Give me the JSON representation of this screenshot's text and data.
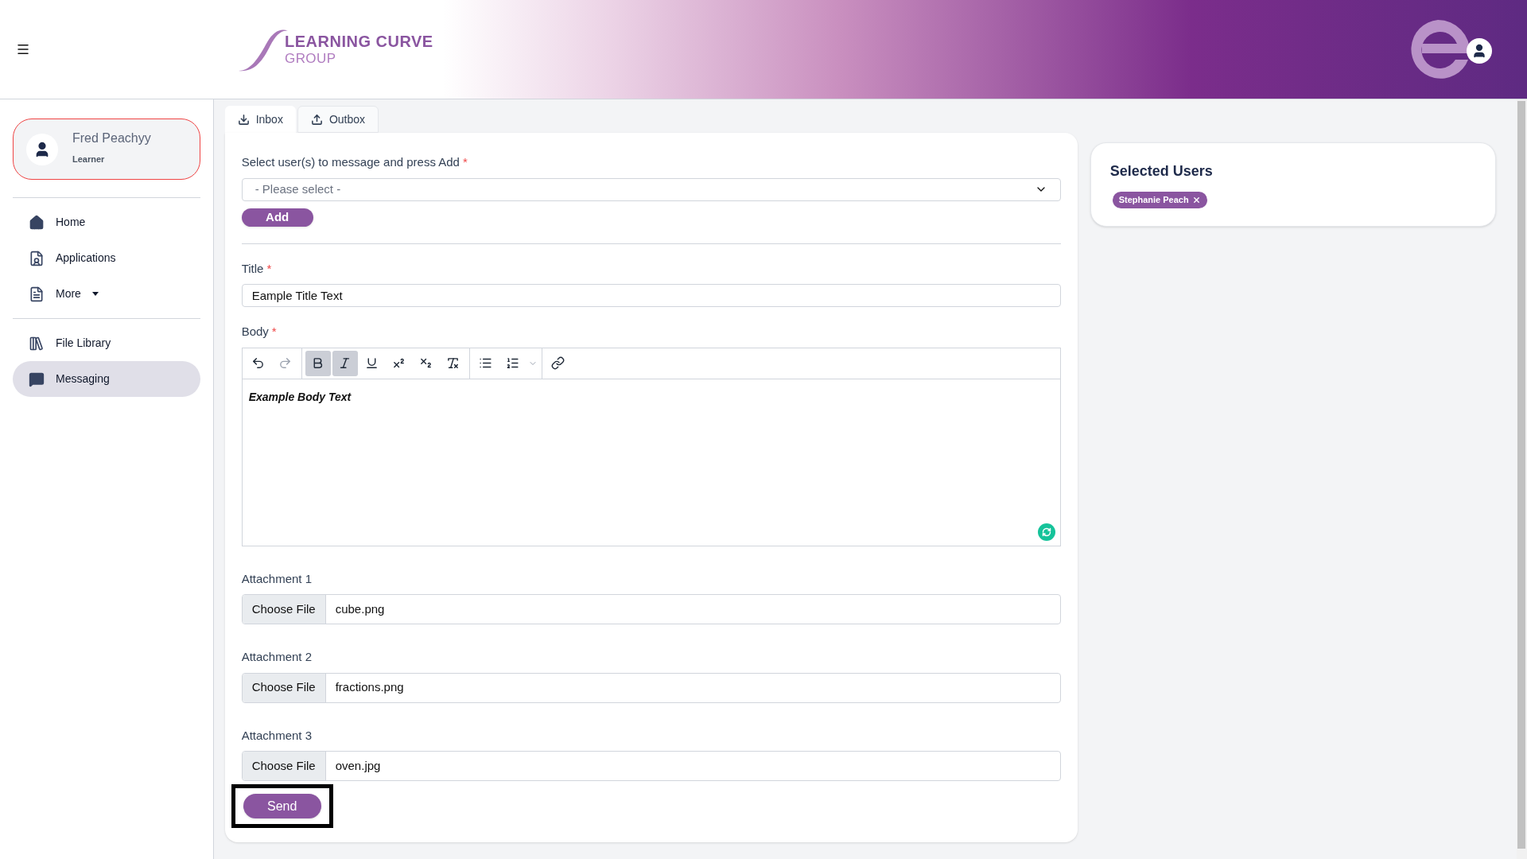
{
  "header": {
    "logo": {
      "line_1": "LEARNING CURVE",
      "line_2": "GROUP"
    }
  },
  "profile": {
    "name": "Fred Peachyy",
    "role": "Learner"
  },
  "nav": [
    {
      "kind": "home",
      "label": "Home",
      "selected": false,
      "dropdown": false
    },
    {
      "kind": "applications",
      "label": "Applications",
      "selected": false,
      "dropdown": false
    },
    {
      "kind": "more",
      "label": "More",
      "selected": false,
      "dropdown": true
    },
    {
      "kind": "library",
      "label": "File Library",
      "selected": false,
      "dropdown": false
    },
    {
      "kind": "messaging",
      "label": "Messaging",
      "selected": true,
      "dropdown": false
    }
  ],
  "tabs": [
    {
      "kind": "inbox",
      "label": "Inbox",
      "selected": true
    },
    {
      "kind": "outbox",
      "label": "Outbox",
      "selected": false
    }
  ],
  "recipients": {
    "label": "Select user(s) to message and press Add",
    "required_mark": "*",
    "placeholder": "- Please select -",
    "add_button": "Add"
  },
  "title_field": {
    "label": "Title",
    "required_mark": "*",
    "value": "Eample Title Text"
  },
  "body_field": {
    "label": "Body",
    "required_mark": "*",
    "value": "Example Body Text",
    "toolbar": [
      [
        {
          "kind": "undo",
          "active": false,
          "disabled": false
        },
        {
          "kind": "redo",
          "active": false,
          "disabled": true
        }
      ],
      [
        {
          "kind": "bold",
          "active": true,
          "disabled": false
        },
        {
          "kind": "italic",
          "active": true,
          "disabled": false
        },
        {
          "kind": "underline",
          "active": false,
          "disabled": false
        },
        {
          "kind": "superscript",
          "active": false,
          "disabled": false
        },
        {
          "kind": "subscript",
          "active": false,
          "disabled": false
        },
        {
          "kind": "clear-format",
          "active": false,
          "disabled": false
        }
      ],
      [
        {
          "kind": "bullet-list",
          "active": false,
          "disabled": false
        },
        {
          "kind": "numbered-list",
          "active": false,
          "disabled": false
        },
        {
          "kind": "dropdown",
          "active": false,
          "disabled": true
        }
      ],
      [
        {
          "kind": "link",
          "active": false,
          "disabled": false
        }
      ]
    ]
  },
  "attachments": [
    {
      "label": "Attachment 1",
      "button": "Choose File",
      "file": "cube.png"
    },
    {
      "label": "Attachment 2",
      "button": "Choose File",
      "file": "fractions.png"
    },
    {
      "label": "Attachment 3",
      "button": "Choose File",
      "file": "oven.jpg"
    }
  ],
  "send_button": {
    "label": "Send",
    "highlighted": true
  },
  "selected_users": {
    "title": "Selected Users",
    "users": [
      {
        "name": "Stephanie Peach"
      }
    ]
  }
}
